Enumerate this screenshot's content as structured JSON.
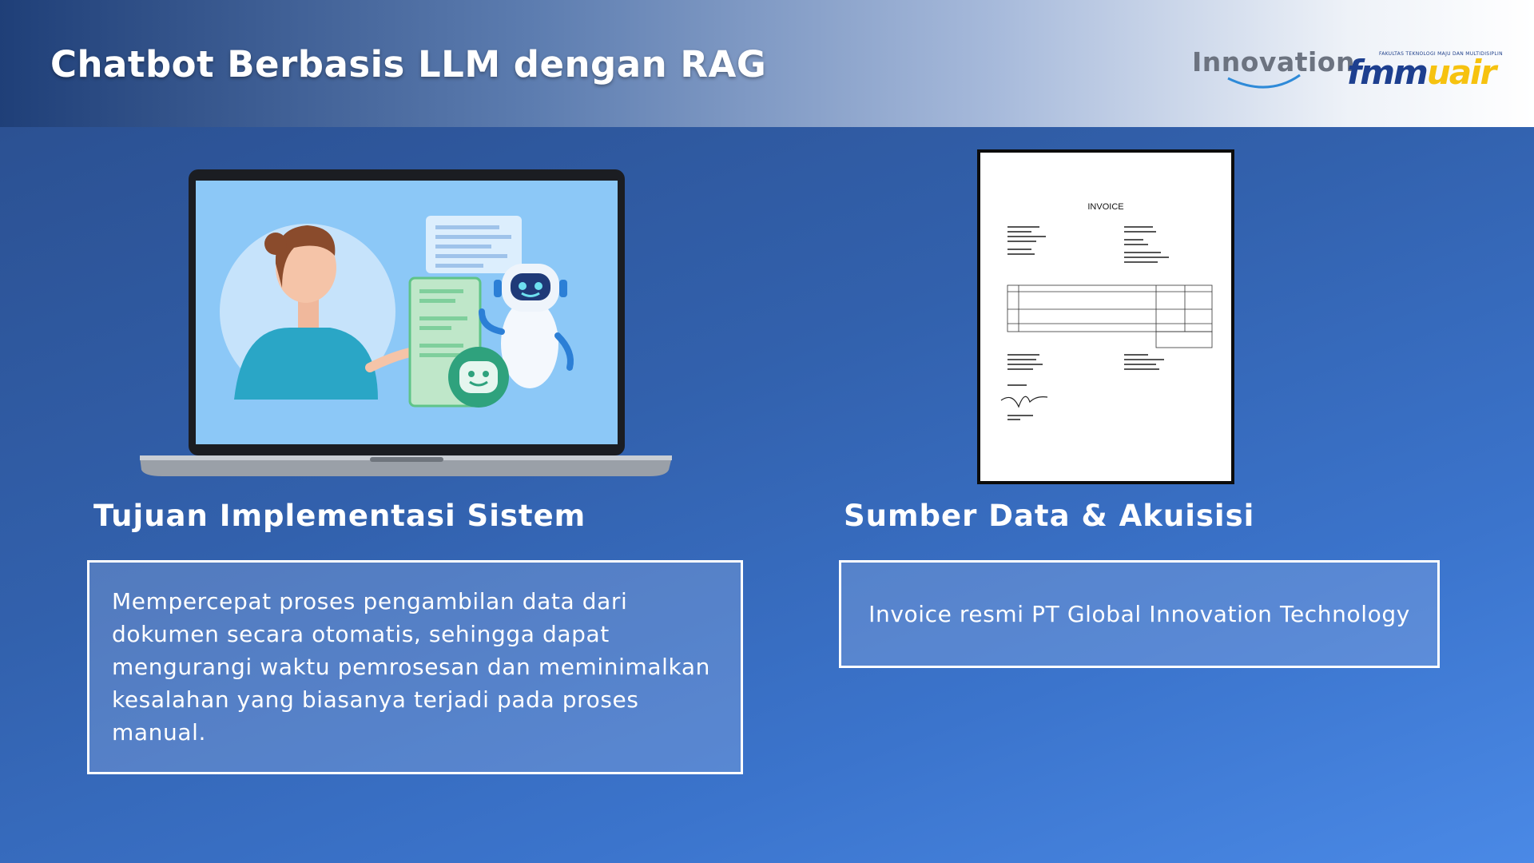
{
  "header": {
    "title": "Chatbot Berbasis LLM dengan RAG",
    "logo_innovation_text": "Innovation",
    "logo_fmm_caption": "FAKULTAS TEKNOLOGI MAJU DAN MULTIDISIPLIN",
    "logo_fmm_mark_a": "fmm",
    "logo_fmm_mark_b": "uair"
  },
  "left_section": {
    "illustration": "laptop-chatbot-illustration",
    "heading": "Tujuan Implementasi Sistem",
    "description": "Mempercepat proses pengambilan data dari dokumen secara otomatis, sehingga dapat mengurangi waktu pemrosesan dan meminimalkan kesalahan yang biasanya terjadi pada proses manual."
  },
  "right_section": {
    "document_title": "INVOICE",
    "heading": "Sumber Data & Akuisisi",
    "description": "Invoice resmi PT Global Innovation Technology"
  },
  "colors": {
    "background_start": "#2a4d8c",
    "background_end": "#4a89e6",
    "text": "#ffffff",
    "logo_blue": "#1d3f8f",
    "logo_yellow": "#f6c20f",
    "screen_blue": "#8cc8f7",
    "bot_green": "#2fa27d"
  }
}
